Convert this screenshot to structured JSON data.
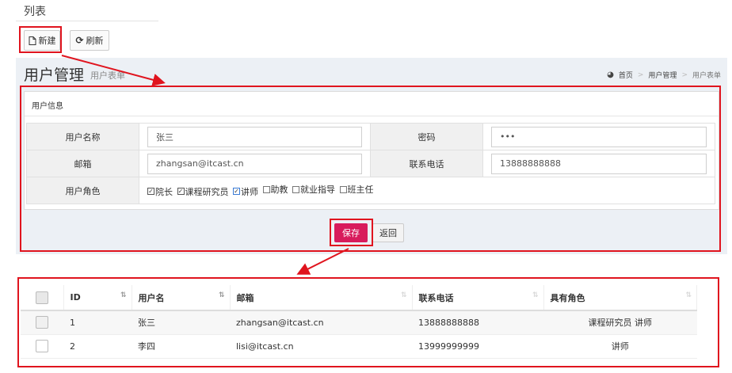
{
  "page": {
    "title": "列表"
  },
  "toolbar": {
    "new_label": "新建",
    "refresh_label": "刷新"
  },
  "header": {
    "title": "用户管理",
    "subtitle": "用户表单"
  },
  "breadcrumb": {
    "home": "首页",
    "level1": "用户管理",
    "level2": "用户表单"
  },
  "form": {
    "section_title": "用户信息",
    "username_label": "用户名称",
    "username_value": "张三",
    "password_label": "密码",
    "password_value": "•••",
    "email_label": "邮箱",
    "email_value": "zhangsan@itcast.cn",
    "phone_label": "联系电话",
    "phone_value": "13888888888",
    "roles_label": "用户角色",
    "roles": [
      {
        "label": "院长",
        "checked": true
      },
      {
        "label": "课程研究员",
        "checked": true
      },
      {
        "label": "讲师",
        "checked": true
      },
      {
        "label": "助教",
        "checked": false
      },
      {
        "label": "就业指导",
        "checked": false
      },
      {
        "label": "班主任",
        "checked": false
      }
    ],
    "save_label": "保存",
    "back_label": "返回"
  },
  "grid": {
    "headers": {
      "id": "ID",
      "username": "用户名",
      "email": "邮箱",
      "phone": "联系电话",
      "roles": "具有角色"
    },
    "rows": [
      {
        "id": "1",
        "username": "张三",
        "email": "zhangsan@itcast.cn",
        "phone": "13888888888",
        "roles": "课程研究员 讲师"
      },
      {
        "id": "2",
        "username": "李四",
        "email": "lisi@itcast.cn",
        "phone": "13999999999",
        "roles": "讲师"
      }
    ]
  },
  "colors": {
    "annotation": "#e0141e",
    "save": "#d81b5c",
    "panel": "#ecf0f5"
  },
  "icons": {
    "new": "file-icon",
    "refresh": "refresh-icon",
    "home": "dashboard-icon"
  }
}
